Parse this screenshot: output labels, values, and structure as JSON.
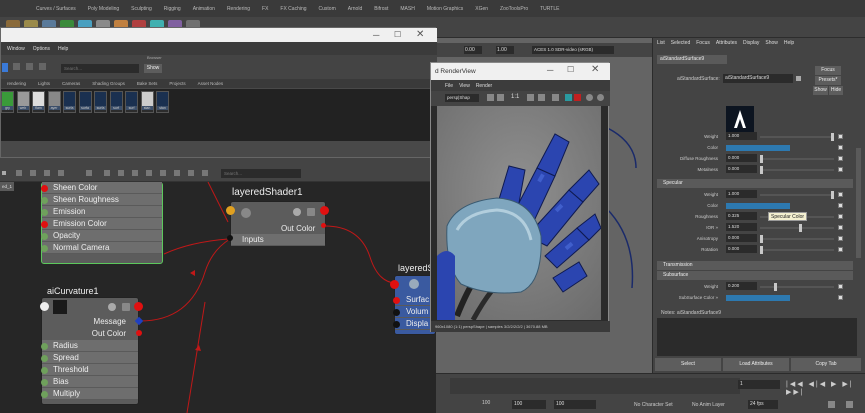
{
  "shelf": {
    "tabs": [
      "Curves / Surfaces",
      "Poly Modeling",
      "Sculpting",
      "Rigging",
      "Animation",
      "Rendering",
      "FX",
      "FX Caching",
      "Custom",
      "Arnold",
      "Bifrost",
      "MASH",
      "Motion Graphics",
      "XGen",
      "ZooToolsPro",
      "TURTLE"
    ]
  },
  "viewport_toolbar": {
    "time_a": "0.00",
    "time_b": "1.00",
    "colorspace": "ACES 1.0 SDR-video (sRGB)"
  },
  "hypershade": {
    "menu": [
      "Window",
      "Options",
      "Help"
    ],
    "browser_label": "Browser",
    "search_placeholder": "Search...",
    "show_label": "Show",
    "tabs": [
      "rendering",
      "Lights",
      "Cameras",
      "Shading Groups",
      "Bake Sets",
      "Projects",
      "Asset Nodes"
    ],
    "materials": [
      "gry",
      "web",
      "flam",
      "ayer",
      "surfa",
      "surfa",
      "surfa",
      "surf",
      "surf",
      "stan",
      "stan"
    ],
    "graph_search_placeholder": "Search...",
    "graph_tab": "ed_1"
  },
  "nodes": {
    "top_rows": [
      "Sheen Color",
      "Sheen Roughness",
      "Emission",
      "Emission Color",
      "Opacity",
      "Normal Camera"
    ],
    "layered_title": "layeredShader1",
    "layered_out": "Out Color",
    "layered_in": "Inputs",
    "curvature_title": "aiCurvature1",
    "curvature_outputs": [
      "Message",
      "Out Color"
    ],
    "curvature_inputs": [
      "Radius",
      "Spread",
      "Threshold",
      "Bias",
      "Multiply"
    ],
    "layered2_title": "layeredS",
    "layered2_rows": [
      "Surfac",
      "Volum",
      "Displa"
    ]
  },
  "renderview": {
    "title": "d RenderView",
    "menu": [
      "File",
      "View",
      "Render"
    ],
    "camera": "persp|Shap",
    "ratio": "1:1",
    "status": "960x1080 (1:1)   perspShape | samples 3/2/2/2/2/2 | 3670.88 MB"
  },
  "attribute_editor": {
    "menu": [
      "List",
      "Selected",
      "Focus",
      "Attributes",
      "Display",
      "Show",
      "Help"
    ],
    "tab": "aiStandardSurface9",
    "node_label": "aiStandardSurface:",
    "node_value": "aiStandardSurface9",
    "focus_label": "Focus",
    "presets_label": "Presets*",
    "show_label": "Show",
    "hide_label": "Hide",
    "base_rows": [
      {
        "label": "Weight",
        "value": "1.000",
        "slider": 1.0
      },
      {
        "label": "Color",
        "value": "",
        "slider": 0.0,
        "color": "#2d79b0"
      },
      {
        "label": "Diffuse Roughness",
        "value": "0.000",
        "slider": 0.0
      },
      {
        "label": "Metalness",
        "value": "0.000",
        "slider": 0.0
      }
    ],
    "specular_section": "Specular",
    "specular_rows": [
      {
        "label": "Weight",
        "value": "1.000",
        "slider": 1.0
      },
      {
        "label": "Color",
        "value": "",
        "slider": 0.0,
        "color": "#2d79b0"
      },
      {
        "label": "Roughness",
        "value": "0.325",
        "slider": 0.325
      },
      {
        "label": "IOR »",
        "value": "1.520",
        "slider": 0.55
      },
      {
        "label": "Anisotropy",
        "value": "0.000",
        "slider": 0.0
      },
      {
        "label": "Rotation",
        "value": "0.000",
        "slider": 0.0
      }
    ],
    "tooltip": "Specular Color",
    "transmission_section": "Transmission",
    "subsurface_section": "Subsurface",
    "subsurface_rows": [
      {
        "label": "Weight",
        "value": "0.200",
        "slider": 0.2
      },
      {
        "label": "SubSurface Color »",
        "value": "",
        "slider": 0.0,
        "color": "#2d79b0"
      }
    ],
    "notes_label": "Notes: aiStandardSurface9",
    "buttons": [
      "Select",
      "Load Attributes",
      "Copy Tab"
    ]
  },
  "timeline": {
    "current_frame": "1",
    "start": "100",
    "range_start": "100",
    "range_end": "100",
    "character_set": "No Character Set",
    "anim_layer": "No Anim Layer",
    "fps": "24 fps"
  },
  "colors": {
    "accent_blue": "#2d79b0",
    "node_pin_red": "#e01010",
    "node_pin_green": "#6fa05c",
    "selection_green": "#5cc85c"
  }
}
